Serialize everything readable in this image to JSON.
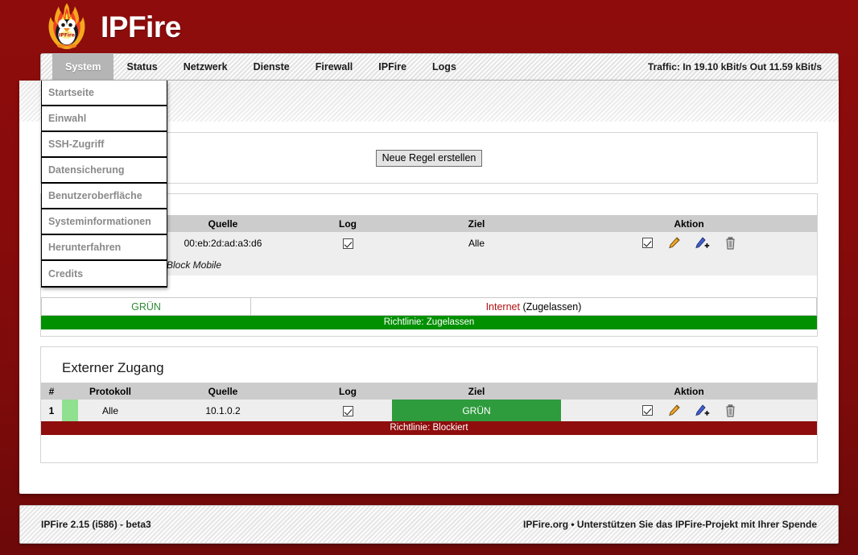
{
  "brand": {
    "title": "IPFire",
    "logo_icon": "ipfire-penguin-flame-logo"
  },
  "nav": {
    "tabs": [
      {
        "label": "System",
        "active": true
      },
      {
        "label": "Status",
        "active": false
      },
      {
        "label": "Netzwerk",
        "active": false
      },
      {
        "label": "Dienste",
        "active": false
      },
      {
        "label": "Firewall",
        "active": false
      },
      {
        "label": "IPFire",
        "active": false
      },
      {
        "label": "Logs",
        "active": false
      }
    ],
    "traffic": "Traffic: In 19.10 kBit/s   Out 11.59 kBit/s"
  },
  "dropdown": {
    "items": [
      {
        "label": "Startseite"
      },
      {
        "label": "Einwahl"
      },
      {
        "label": "SSH-Zugriff"
      },
      {
        "label": "Datensicherung"
      },
      {
        "label": "Benutzeroberfläche"
      },
      {
        "label": "Systeminformationen"
      },
      {
        "label": "Herunterfahren"
      },
      {
        "label": "Credits"
      }
    ]
  },
  "toolbar": {
    "new_rule_label": "Neue Regel erstellen"
  },
  "rules_table": {
    "headers": [
      "",
      "",
      "Quelle",
      "Log",
      "Ziel",
      "Aktion"
    ],
    "rows": [
      {
        "index": "",
        "swatch_color": "#eeeeee",
        "protocol": "",
        "source": "00:eb:2d:ad:a3:d6",
        "log_checked": true,
        "target": "Alle",
        "target_highlight": false,
        "enabled_checked": true
      },
      {
        "index": "",
        "swatch_color": "#f07a5e",
        "protocol": "",
        "source": "Block Mobile",
        "source_italic": true,
        "log_checked": false,
        "target": "",
        "target_highlight": false,
        "enabled_checked": false
      }
    ],
    "summary": {
      "source_zone": "GRÜN",
      "target_zone": "Internet",
      "target_state": "(Zugelassen)"
    },
    "policy": {
      "label": "Richtlinie: Zugelassen",
      "color": "#009000"
    }
  },
  "external_access": {
    "title": "Externer Zugang",
    "headers": [
      "#",
      "",
      "Protokoll",
      "Quelle",
      "Log",
      "Ziel",
      "Aktion"
    ],
    "rows": [
      {
        "index": "1",
        "swatch_color": "#8fe08f",
        "protocol": "Alle",
        "source": "10.1.0.2",
        "log_checked": true,
        "target": "GRÜN",
        "target_highlight": true,
        "enabled_checked": true
      }
    ],
    "policy": {
      "label": "Richtlinie: Blockiert",
      "color": "#8f0d0d"
    }
  },
  "action_icons": {
    "enabled": "checkbox-icon",
    "edit": "pencil-edit-icon",
    "copy": "pencil-add-icon",
    "delete": "trash-delete-icon"
  },
  "footer": {
    "version": "IPFire 2.15 (i586) - beta3",
    "credit": "IPFire.org • Unterstützen Sie das IPFire-Projekt mit Ihrer Spende"
  },
  "colors": {
    "brand_red": "#8f0d0d",
    "policy_allow": "#009000",
    "policy_block": "#8f0d0d",
    "zone_green": "#2e9b3d"
  }
}
